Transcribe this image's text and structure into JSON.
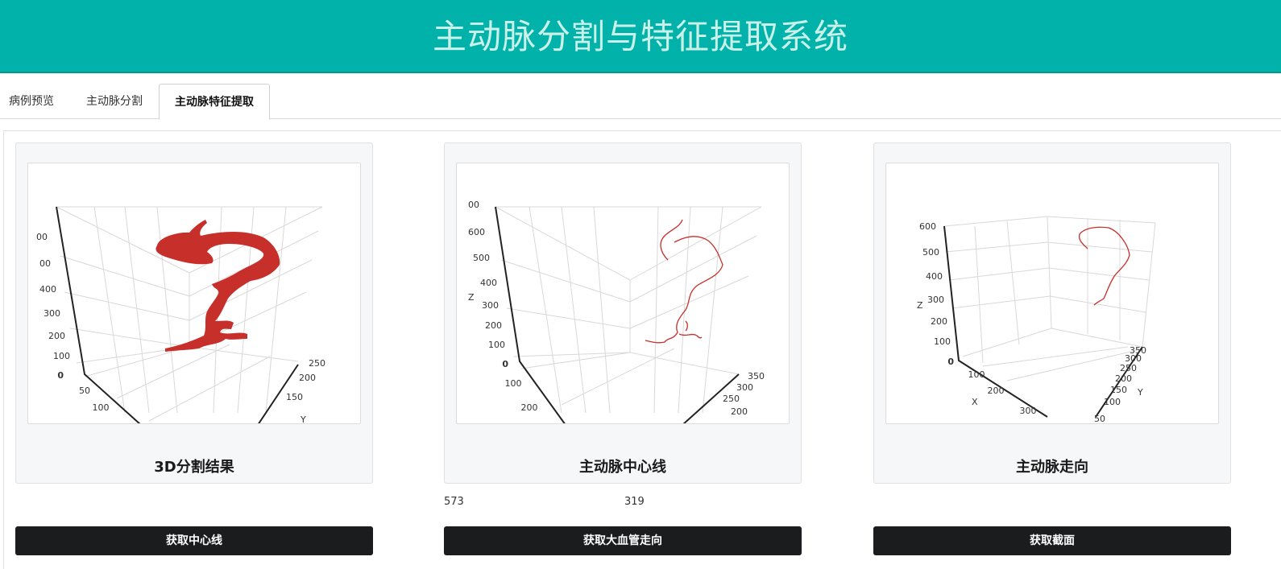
{
  "header": {
    "title": "主动脉分割与特征提取系统"
  },
  "tabs": [
    {
      "label": "病例预览",
      "active": false
    },
    {
      "label": "主动脉分割",
      "active": false
    },
    {
      "label": "主动脉特征提取",
      "active": true
    }
  ],
  "cards": [
    {
      "title": "3D分割结果",
      "z_ticks": [
        "0",
        "100",
        "200",
        "300",
        "400",
        "00",
        "00"
      ],
      "x_ticks": [
        "50",
        "100"
      ],
      "y_ticks": [
        "150",
        "200",
        "250"
      ],
      "y_label": "Y"
    },
    {
      "title": "主动脉中心线",
      "z_ticks": [
        "0",
        "100",
        "200",
        "300",
        "400",
        "500",
        "600",
        "00"
      ],
      "x_ticks": [
        "100",
        "200"
      ],
      "y_ticks": [
        "200",
        "250",
        "300",
        "350"
      ],
      "z_label": "Z"
    },
    {
      "title": "主动脉走向",
      "z_ticks": [
        "0",
        "100",
        "200",
        "300",
        "400",
        "500",
        "600"
      ],
      "x_ticks": [
        "100",
        "200",
        "300"
      ],
      "y_ticks": [
        "50",
        "100",
        "150",
        "200",
        "250",
        "300",
        "350"
      ],
      "x_label": "X",
      "y_label": "Y",
      "z_label": "Z"
    }
  ],
  "readouts": {
    "left": "573",
    "right": "319"
  },
  "buttons": {
    "centerline": "获取中心线",
    "direction": "获取大血管走向",
    "section": "获取截面"
  },
  "colors": {
    "header": "#00b2a9",
    "header_text": "#c9f1e9",
    "vessel": "#c62f2a",
    "button": "#1b1c1e"
  }
}
